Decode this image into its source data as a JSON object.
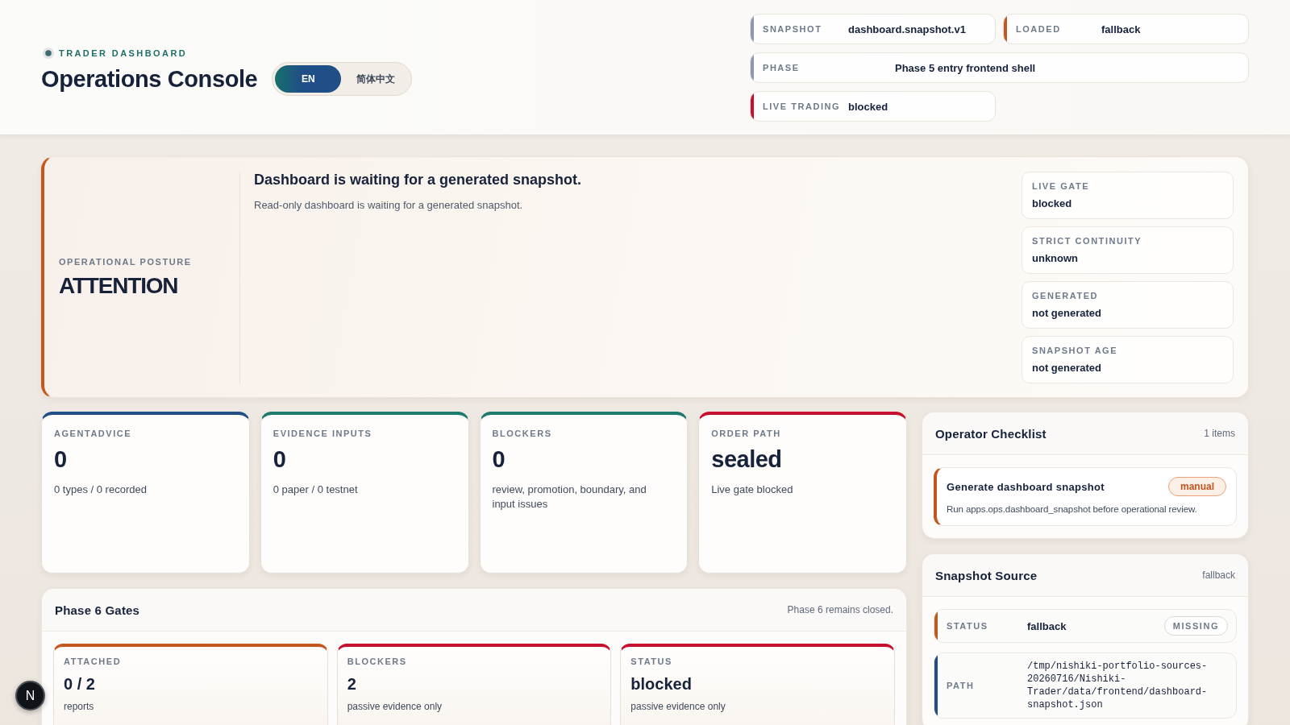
{
  "header": {
    "eyebrow": "TRADER DASHBOARD",
    "title": "Operations Console",
    "languages": [
      {
        "label": "EN",
        "selected": true
      },
      {
        "label": "简体中文",
        "selected": false
      }
    ],
    "meta": [
      {
        "label": "SNAPSHOT",
        "value": "dashboard.snapshot.v1",
        "color": "#8e9aab"
      },
      {
        "label": "LOADED",
        "value": "fallback",
        "color": "#c4561f"
      },
      {
        "label": "PHASE",
        "value": "Phase 5 entry frontend shell",
        "color": "#8e9aab"
      },
      {
        "label": "LIVE TRADING",
        "value": "blocked",
        "color": "#c8102e"
      }
    ]
  },
  "posture": {
    "label": "OPERATIONAL POSTURE",
    "value": "ATTENTION",
    "headline": "Dashboard is waiting for a generated snapshot.",
    "detail": "Read-only dashboard is waiting for a generated snapshot.",
    "facts": [
      {
        "label": "LIVE GATE",
        "value": "blocked"
      },
      {
        "label": "STRICT CONTINUITY",
        "value": "unknown"
      },
      {
        "label": "GENERATED",
        "value": "not generated"
      },
      {
        "label": "SNAPSHOT AGE",
        "value": "not generated"
      }
    ]
  },
  "metrics": [
    {
      "label": "AGENTADVICE",
      "value": "0",
      "detail": "0 types / 0 recorded",
      "color": "#1f4f86"
    },
    {
      "label": "EVIDENCE INPUTS",
      "value": "0",
      "detail": "0 paper / 0 testnet",
      "color": "#1a7a6e"
    },
    {
      "label": "BLOCKERS",
      "value": "0",
      "detail": "review, promotion, boundary, and input issues",
      "color": "#1a7a6e"
    },
    {
      "label": "ORDER PATH",
      "value": "sealed",
      "detail": "Live gate blocked",
      "color": "#c8102e"
    }
  ],
  "phase_gates": {
    "title": "Phase 6 Gates",
    "note": "Phase 6 remains closed.",
    "gates": [
      {
        "label": "ATTACHED",
        "value": "0 / 2",
        "detail": "reports",
        "color": "#c4561f"
      },
      {
        "label": "BLOCKERS",
        "value": "2",
        "detail": "passive evidence only",
        "color": "#c8102e"
      },
      {
        "label": "STATUS",
        "value": "blocked",
        "detail": "passive evidence only",
        "color": "#c8102e"
      }
    ]
  },
  "checklist": {
    "title": "Operator Checklist",
    "count": "1 items",
    "items": [
      {
        "title": "Generate dashboard snapshot",
        "tag": "manual",
        "detail": "Run apps.ops.dashboard_snapshot before operational review.",
        "color": "#c4561f"
      }
    ]
  },
  "snapshot_source": {
    "title": "Snapshot Source",
    "note": "fallback",
    "rows": [
      {
        "kind": "status",
        "label": "STATUS",
        "value": "fallback",
        "tag": "MISSING",
        "color": "#c4561f"
      },
      {
        "kind": "path",
        "label": "PATH",
        "value": "/tmp/nishiki-portfolio-sources-20260716/Nishiki-Trader/data/frontend/dashboard-snapshot.json",
        "color": "#1f4f86"
      }
    ]
  },
  "dev_indicator": {
    "label": "N"
  }
}
